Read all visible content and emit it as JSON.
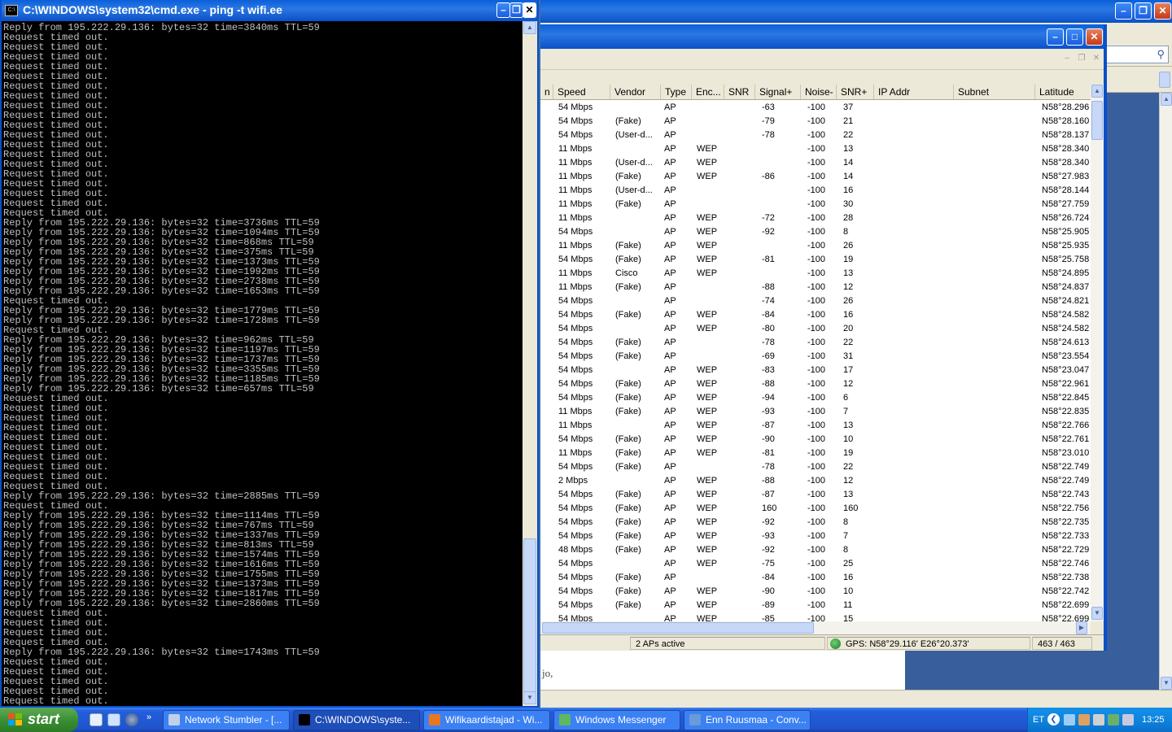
{
  "cmd": {
    "title": "C:\\WINDOWS\\system32\\cmd.exe - ping -t wifi.ee",
    "lines": [
      "Reply from 195.222.29.136: bytes=32 time=3840ms TTL=59",
      "Request timed out.",
      "Request timed out.",
      "Request timed out.",
      "Request timed out.",
      "Request timed out.",
      "Request timed out.",
      "Request timed out.",
      "Request timed out.",
      "Request timed out.",
      "Request timed out.",
      "Request timed out.",
      "Request timed out.",
      "Request timed out.",
      "Request timed out.",
      "Request timed out.",
      "Request timed out.",
      "Request timed out.",
      "Request timed out.",
      "Request timed out.",
      "Reply from 195.222.29.136: bytes=32 time=3736ms TTL=59",
      "Reply from 195.222.29.136: bytes=32 time=1094ms TTL=59",
      "Reply from 195.222.29.136: bytes=32 time=868ms TTL=59",
      "Reply from 195.222.29.136: bytes=32 time=375ms TTL=59",
      "Reply from 195.222.29.136: bytes=32 time=1373ms TTL=59",
      "Reply from 195.222.29.136: bytes=32 time=1992ms TTL=59",
      "Reply from 195.222.29.136: bytes=32 time=2738ms TTL=59",
      "Reply from 195.222.29.136: bytes=32 time=1653ms TTL=59",
      "Request timed out.",
      "Reply from 195.222.29.136: bytes=32 time=1779ms TTL=59",
      "Reply from 195.222.29.136: bytes=32 time=1728ms TTL=59",
      "Request timed out.",
      "Reply from 195.222.29.136: bytes=32 time=962ms TTL=59",
      "Reply from 195.222.29.136: bytes=32 time=1197ms TTL=59",
      "Reply from 195.222.29.136: bytes=32 time=1737ms TTL=59",
      "Reply from 195.222.29.136: bytes=32 time=3355ms TTL=59",
      "Reply from 195.222.29.136: bytes=32 time=1185ms TTL=59",
      "Reply from 195.222.29.136: bytes=32 time=657ms TTL=59",
      "Request timed out.",
      "Request timed out.",
      "Request timed out.",
      "Request timed out.",
      "Request timed out.",
      "Request timed out.",
      "Request timed out.",
      "Request timed out.",
      "Request timed out.",
      "Request timed out.",
      "Reply from 195.222.29.136: bytes=32 time=2885ms TTL=59",
      "Request timed out.",
      "Reply from 195.222.29.136: bytes=32 time=1114ms TTL=59",
      "Reply from 195.222.29.136: bytes=32 time=767ms TTL=59",
      "Reply from 195.222.29.136: bytes=32 time=1337ms TTL=59",
      "Reply from 195.222.29.136: bytes=32 time=813ms TTL=59",
      "Reply from 195.222.29.136: bytes=32 time=1574ms TTL=59",
      "Reply from 195.222.29.136: bytes=32 time=1616ms TTL=59",
      "Reply from 195.222.29.136: bytes=32 time=1755ms TTL=59",
      "Reply from 195.222.29.136: bytes=32 time=1373ms TTL=59",
      "Reply from 195.222.29.136: bytes=32 time=1817ms TTL=59",
      "Reply from 195.222.29.136: bytes=32 time=2860ms TTL=59",
      "Request timed out.",
      "Request timed out.",
      "Request timed out.",
      "Request timed out.",
      "Reply from 195.222.29.136: bytes=32 time=1743ms TTL=59",
      "Request timed out.",
      "Request timed out.",
      "Request timed out.",
      "Request timed out.",
      "Request timed out."
    ]
  },
  "netstumbler": {
    "columns": [
      "n",
      "Speed",
      "Vendor",
      "Type",
      "Enc...",
      "SNR",
      "Signal+",
      "Noise-",
      "SNR+",
      "IP Addr",
      "Subnet",
      "Latitude"
    ],
    "rows": [
      [
        "54 Mbps",
        "",
        "AP",
        "",
        "",
        "-63",
        "-100",
        "37",
        "N58°28.296"
      ],
      [
        "54 Mbps",
        "(Fake)",
        "AP",
        "",
        "",
        "-79",
        "-100",
        "21",
        "N58°28.160"
      ],
      [
        "54 Mbps",
        "(User-d...",
        "AP",
        "",
        "",
        "-78",
        "-100",
        "22",
        "N58°28.137"
      ],
      [
        "11 Mbps",
        "",
        "AP",
        "WEP",
        "",
        "",
        "-100",
        "13",
        "N58°28.340"
      ],
      [
        "11 Mbps",
        "(User-d...",
        "AP",
        "WEP",
        "",
        "",
        "-100",
        "14",
        "N58°28.340"
      ],
      [
        "11 Mbps",
        "(Fake)",
        "AP",
        "WEP",
        "",
        "-86",
        "-100",
        "14",
        "N58°27.983"
      ],
      [
        "11 Mbps",
        "(User-d...",
        "AP",
        "",
        "",
        "",
        "-100",
        "16",
        "N58°28.144"
      ],
      [
        "11 Mbps",
        "(Fake)",
        "AP",
        "",
        "",
        "",
        "-100",
        "30",
        "N58°27.759"
      ],
      [
        "11 Mbps",
        "",
        "AP",
        "WEP",
        "",
        "-72",
        "-100",
        "28",
        "N58°26.724"
      ],
      [
        "54 Mbps",
        "",
        "AP",
        "WEP",
        "",
        "-92",
        "-100",
        "8",
        "N58°25.905"
      ],
      [
        "11 Mbps",
        "(Fake)",
        "AP",
        "WEP",
        "",
        "",
        "-100",
        "26",
        "N58°25.935"
      ],
      [
        "54 Mbps",
        "(Fake)",
        "AP",
        "WEP",
        "",
        "-81",
        "-100",
        "19",
        "N58°25.758"
      ],
      [
        "11 Mbps",
        "Cisco",
        "AP",
        "WEP",
        "",
        "",
        "-100",
        "13",
        "N58°24.895"
      ],
      [
        "11 Mbps",
        "(Fake)",
        "AP",
        "",
        "",
        "-88",
        "-100",
        "12",
        "N58°24.837"
      ],
      [
        "54 Mbps",
        "",
        "AP",
        "",
        "",
        "-74",
        "-100",
        "26",
        "N58°24.821"
      ],
      [
        "54 Mbps",
        "(Fake)",
        "AP",
        "WEP",
        "",
        "-84",
        "-100",
        "16",
        "N58°24.582"
      ],
      [
        "54 Mbps",
        "",
        "AP",
        "WEP",
        "",
        "-80",
        "-100",
        "20",
        "N58°24.582"
      ],
      [
        "54 Mbps",
        "(Fake)",
        "AP",
        "",
        "",
        "-78",
        "-100",
        "22",
        "N58°24.613"
      ],
      [
        "54 Mbps",
        "(Fake)",
        "AP",
        "",
        "",
        "-69",
        "-100",
        "31",
        "N58°23.554"
      ],
      [
        "54 Mbps",
        "",
        "AP",
        "WEP",
        "",
        "-83",
        "-100",
        "17",
        "N58°23.047"
      ],
      [
        "54 Mbps",
        "(Fake)",
        "AP",
        "WEP",
        "",
        "-88",
        "-100",
        "12",
        "N58°22.961"
      ],
      [
        "54 Mbps",
        "(Fake)",
        "AP",
        "WEP",
        "",
        "-94",
        "-100",
        "6",
        "N58°22.845"
      ],
      [
        "11 Mbps",
        "(Fake)",
        "AP",
        "WEP",
        "",
        "-93",
        "-100",
        "7",
        "N58°22.835"
      ],
      [
        "11 Mbps",
        "",
        "AP",
        "WEP",
        "",
        "-87",
        "-100",
        "13",
        "N58°22.766"
      ],
      [
        "54 Mbps",
        "(Fake)",
        "AP",
        "WEP",
        "",
        "-90",
        "-100",
        "10",
        "N58°22.761"
      ],
      [
        "11 Mbps",
        "(Fake)",
        "AP",
        "WEP",
        "",
        "-81",
        "-100",
        "19",
        "N58°23.010"
      ],
      [
        "54 Mbps",
        "(Fake)",
        "AP",
        "",
        "",
        "-78",
        "-100",
        "22",
        "N58°22.749"
      ],
      [
        "2 Mbps",
        "",
        "AP",
        "WEP",
        "",
        "-88",
        "-100",
        "12",
        "N58°22.749"
      ],
      [
        "54 Mbps",
        "(Fake)",
        "AP",
        "WEP",
        "",
        "-87",
        "-100",
        "13",
        "N58°22.743"
      ],
      [
        "54 Mbps",
        "(Fake)",
        "AP",
        "WEP",
        "",
        "160",
        "-100",
        "160",
        "N58°22.756"
      ],
      [
        "54 Mbps",
        "(Fake)",
        "AP",
        "WEP",
        "",
        "-92",
        "-100",
        "8",
        "N58°22.735"
      ],
      [
        "54 Mbps",
        "(Fake)",
        "AP",
        "WEP",
        "",
        "-93",
        "-100",
        "7",
        "N58°22.733"
      ],
      [
        "48 Mbps",
        "(Fake)",
        "AP",
        "WEP",
        "",
        "-92",
        "-100",
        "8",
        "N58°22.729"
      ],
      [
        "54 Mbps",
        "",
        "AP",
        "WEP",
        "",
        "-75",
        "-100",
        "25",
        "N58°22.746"
      ],
      [
        "54 Mbps",
        "(Fake)",
        "AP",
        "",
        "",
        "-84",
        "-100",
        "16",
        "N58°22.738"
      ],
      [
        "54 Mbps",
        "(Fake)",
        "AP",
        "WEP",
        "",
        "-90",
        "-100",
        "10",
        "N58°22.742"
      ],
      [
        "54 Mbps",
        "(Fake)",
        "AP",
        "WEP",
        "",
        "-89",
        "-100",
        "11",
        "N58°22.699"
      ],
      [
        "54 Mbps",
        "",
        "AP",
        "WEP",
        "",
        "-85",
        "-100",
        "15",
        "N58°22.699"
      ]
    ],
    "status": {
      "aps_active": "2 APs active",
      "gps": "GPS: N58°29.116' E26°20.373'",
      "count": "463 / 463"
    }
  },
  "browser": {
    "content_snippet": "jo,"
  },
  "taskbar": {
    "start_label": "start",
    "tasks": [
      {
        "label": "Network Stumbler - [...",
        "active": false
      },
      {
        "label": "C:\\WINDOWS\\syste...",
        "active": true
      },
      {
        "label": "Wifikaardistajad - Wi...",
        "active": false
      },
      {
        "label": "Windows Messenger",
        "active": false
      },
      {
        "label": "Enn Ruusmaa - Conv...",
        "active": false
      }
    ],
    "language": "ET",
    "clock": "13:25"
  },
  "colors": {
    "xp_blue": "#245edb",
    "start_green": "#3c8f34",
    "console_text": "#c0c0c0",
    "console_bg": "#000000"
  }
}
